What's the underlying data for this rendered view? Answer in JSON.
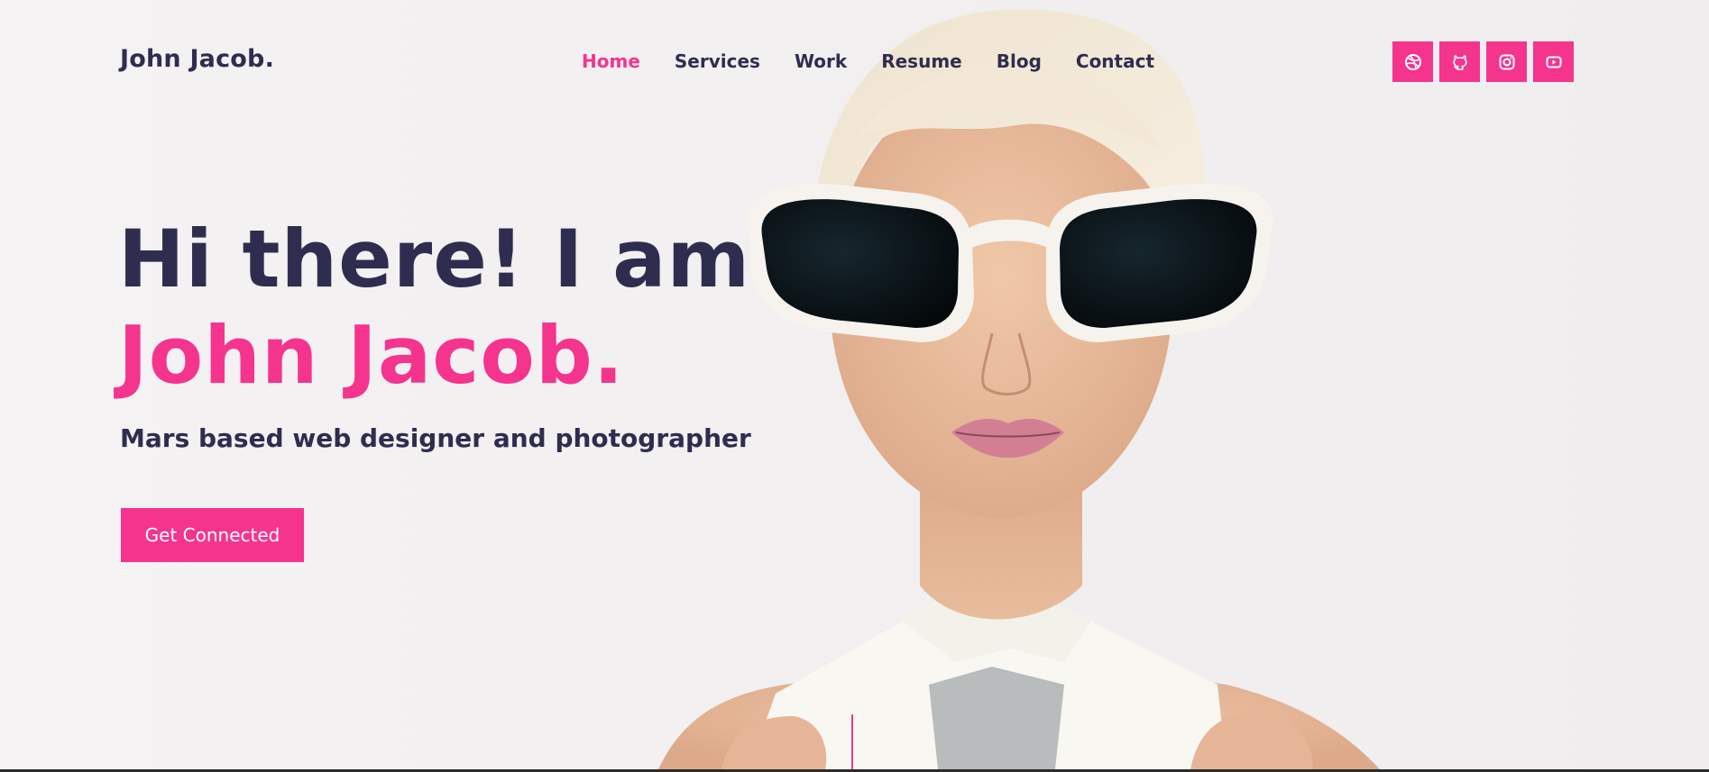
{
  "header": {
    "logo": "John Jacob.",
    "nav": [
      {
        "label": "Home",
        "active": true
      },
      {
        "label": "Services",
        "active": false
      },
      {
        "label": "Work",
        "active": false
      },
      {
        "label": "Resume",
        "active": false
      },
      {
        "label": "Blog",
        "active": false
      },
      {
        "label": "Contact",
        "active": false
      }
    ],
    "social_icons": [
      "dribbble-icon",
      "github-icon",
      "instagram-icon",
      "youtube-icon"
    ]
  },
  "hero": {
    "greeting": "Hi there! I am",
    "name": "John Jacob.",
    "tagline": "Mars based web designer and photographer",
    "cta_label": "Get Connected"
  },
  "colors": {
    "accent": "#f5348e",
    "text": "#2f2d4f",
    "background": "#f1efef"
  }
}
